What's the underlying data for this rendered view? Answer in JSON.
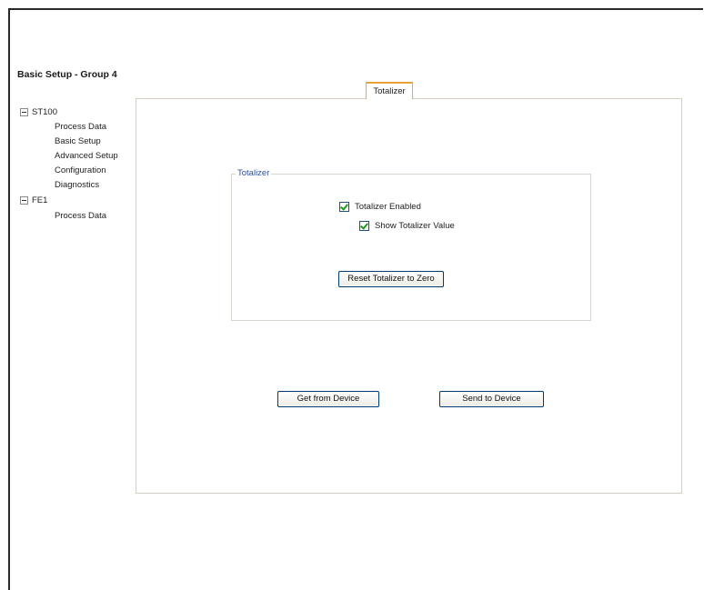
{
  "page": {
    "title": "Basic Setup - Group 4"
  },
  "tree": {
    "nodes": [
      {
        "label": "ST100",
        "expanded": true
      },
      {
        "label": "Process Data"
      },
      {
        "label": "Basic Setup"
      },
      {
        "label": "Advanced Setup"
      },
      {
        "label": "Configuration"
      },
      {
        "label": "Diagnostics"
      },
      {
        "label": "FE1",
        "expanded": true
      },
      {
        "label": "Process Data"
      }
    ]
  },
  "tabs": {
    "active": "Totalizer"
  },
  "totalizer_group": {
    "label": "Totalizer",
    "enabled_label": "Totalizer Enabled",
    "enabled_checked": true,
    "show_value_label": "Show Totalizer Value",
    "show_value_checked": true,
    "reset_label": "Reset Totalizer to Zero"
  },
  "actions": {
    "get_label": "Get from Device",
    "send_label": "Send to Device"
  },
  "colors": {
    "frame": "#2a2a2a",
    "group_label": "#2c4f9e",
    "tab_accent": "#e8a23a",
    "button_border": "#003c74",
    "check_mark": "#1c9a1c"
  },
  "icons": [
    "collapse-icon",
    "checkmark-icon"
  ]
}
